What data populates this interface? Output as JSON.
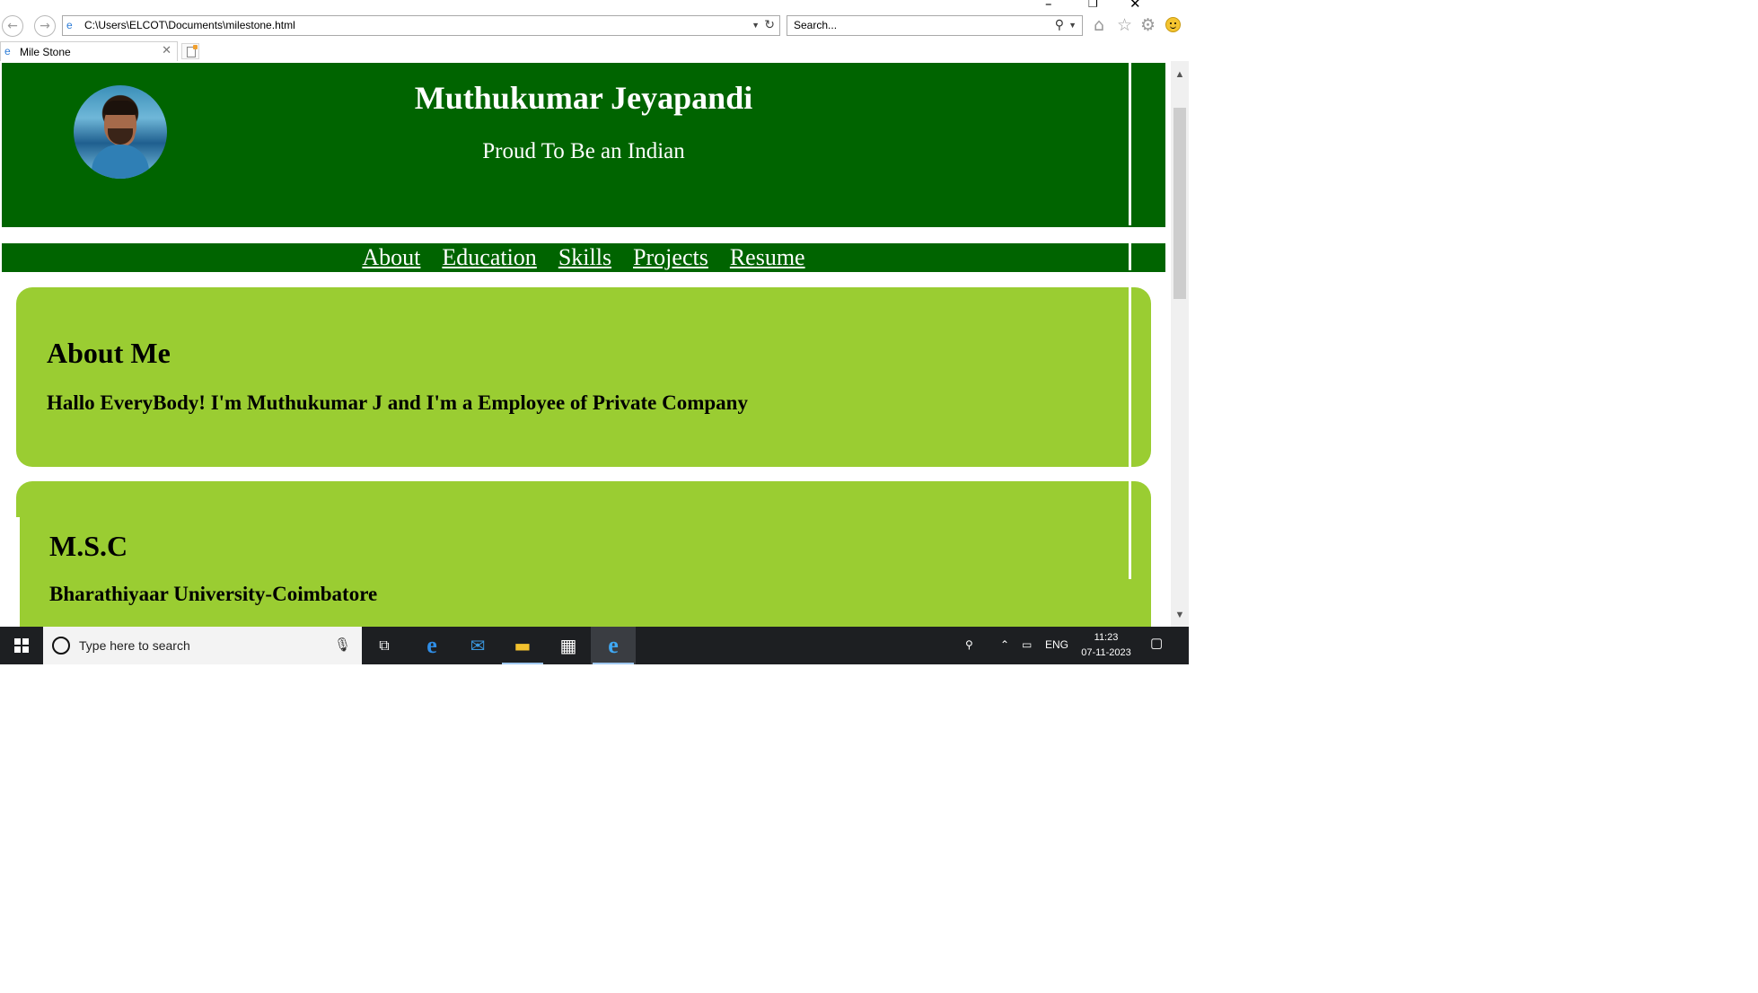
{
  "window": {
    "minimize_glyph": "–",
    "restore_glyph": "❐",
    "close_glyph": "✕"
  },
  "browser": {
    "back_glyph": "←",
    "forward_glyph": "→",
    "url": "C:\\Users\\ELCOT\\Documents\\milestone.html",
    "search_placeholder": "Search...",
    "tab_title": "Mile Stone",
    "tab_close_glyph": "✕",
    "toolbar_icons": [
      "home-icon",
      "favorites-star-icon",
      "settings-gear-icon",
      "feedback-smiley-icon"
    ]
  },
  "page": {
    "name": "Muthukumar Jeyapandi",
    "tagline": "Proud To Be an Indian",
    "nav": [
      "About",
      "Education",
      "Skills",
      "Projects",
      "Resume"
    ],
    "about": {
      "heading": "About Me",
      "text": "Hallo EveryBody! I'm Muthukumar J and I'm a Employee of Private Company"
    },
    "education": {
      "heading": "M.S.C",
      "text": "Bharathiyaar University-Coimbatore"
    },
    "colors": {
      "header_bg": "#006400",
      "card_bg": "#9acd32"
    }
  },
  "taskbar": {
    "search_placeholder": "Type here to search",
    "apps": [
      "task-view-icon",
      "edge-icon",
      "mail-icon",
      "file-explorer-icon",
      "store-icon",
      "internet-explorer-icon"
    ],
    "language": "ENG",
    "time": "11:23",
    "date": "07-11-2023"
  }
}
